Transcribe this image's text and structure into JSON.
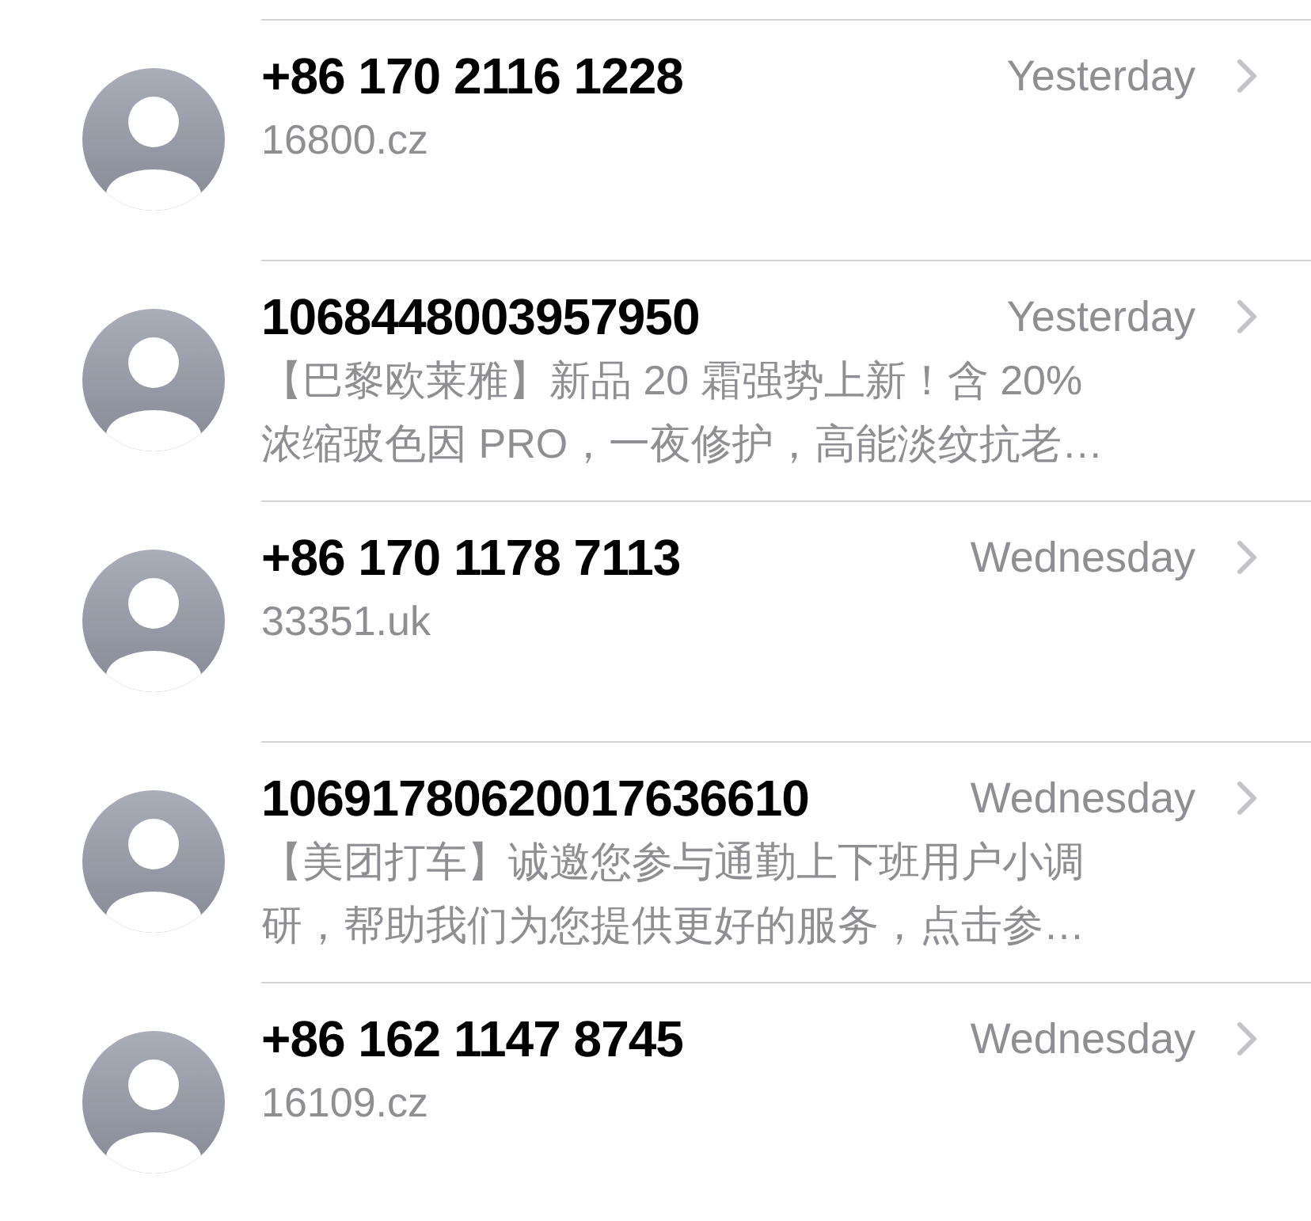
{
  "conversations": [
    {
      "sender": "+86 170 2116 1228",
      "time": "Yesterday",
      "preview": [
        "16800.cz"
      ]
    },
    {
      "sender": "1068448003957950",
      "time": "Yesterday",
      "preview": [
        "【巴黎欧莱雅】新品 20 霜强势上新！含 20%",
        "浓缩玻色因 PRO，一夜修护，高能淡纹抗老…"
      ]
    },
    {
      "sender": "+86 170 1178 7113",
      "time": "Wednesday",
      "preview": [
        "33351.uk"
      ]
    },
    {
      "sender": "10691780620017636610",
      "time": "Wednesday",
      "preview": [
        "【美团打车】诚邀您参与通勤上下班用户小调",
        "研，帮助我们为您提供更好的服务，点击参…"
      ]
    },
    {
      "sender": "+86 162 1147 8745",
      "time": "Wednesday",
      "preview": [
        "16109.cz"
      ]
    }
  ]
}
